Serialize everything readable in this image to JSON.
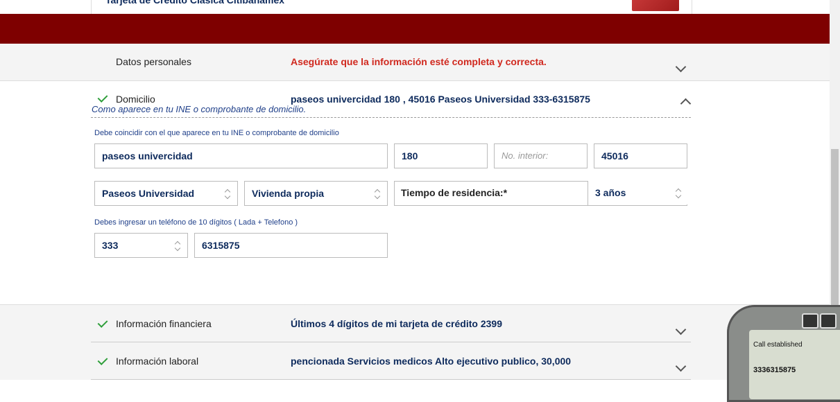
{
  "top_card": {
    "title": "Tarjeta de Crédito Clásica Citibanamex"
  },
  "sections": {
    "personal": {
      "label": "Datos personales",
      "warning": "Asegúrate que la información esté completa y correcta."
    },
    "address": {
      "label": "Domicilio",
      "summary": "paseos univercidad 180 , 45016 Paseos Universidad 333-6315875",
      "hint": "Como aparece en tu INE o comprobante de domicilio.",
      "helper": "Debe coincidir con el que aparece en tu INE o comprobante de domicilio",
      "street": "paseos univercidad",
      "ext_number": "180",
      "int_number_placeholder": "No. interior:",
      "zip": "45016",
      "colony": "Paseos Universidad",
      "housing": "Vivienda propia",
      "residence_label": "Tiempo de residencia:*",
      "residence_value": "3 años",
      "phone_helper": "Debes ingresar un teléfono de 10 dígitos ( Lada + Telefono )",
      "lada": "333",
      "phone": "6315875"
    },
    "financial": {
      "label": "Información financiera",
      "summary": "Últimos 4 dígitos de mi tarjeta de crédito 2399"
    },
    "labor": {
      "label": "Información laboral",
      "summary": "pencionada Servicios medicos Alto ejecutivo publico, 30,000"
    }
  },
  "softphone": {
    "status": "Call established",
    "number": "3336315875"
  },
  "colors": {
    "brand_red": "#7e0000",
    "warning": "#d0281e",
    "navy": "#0d2a5c",
    "check": "#2e9e3a"
  }
}
